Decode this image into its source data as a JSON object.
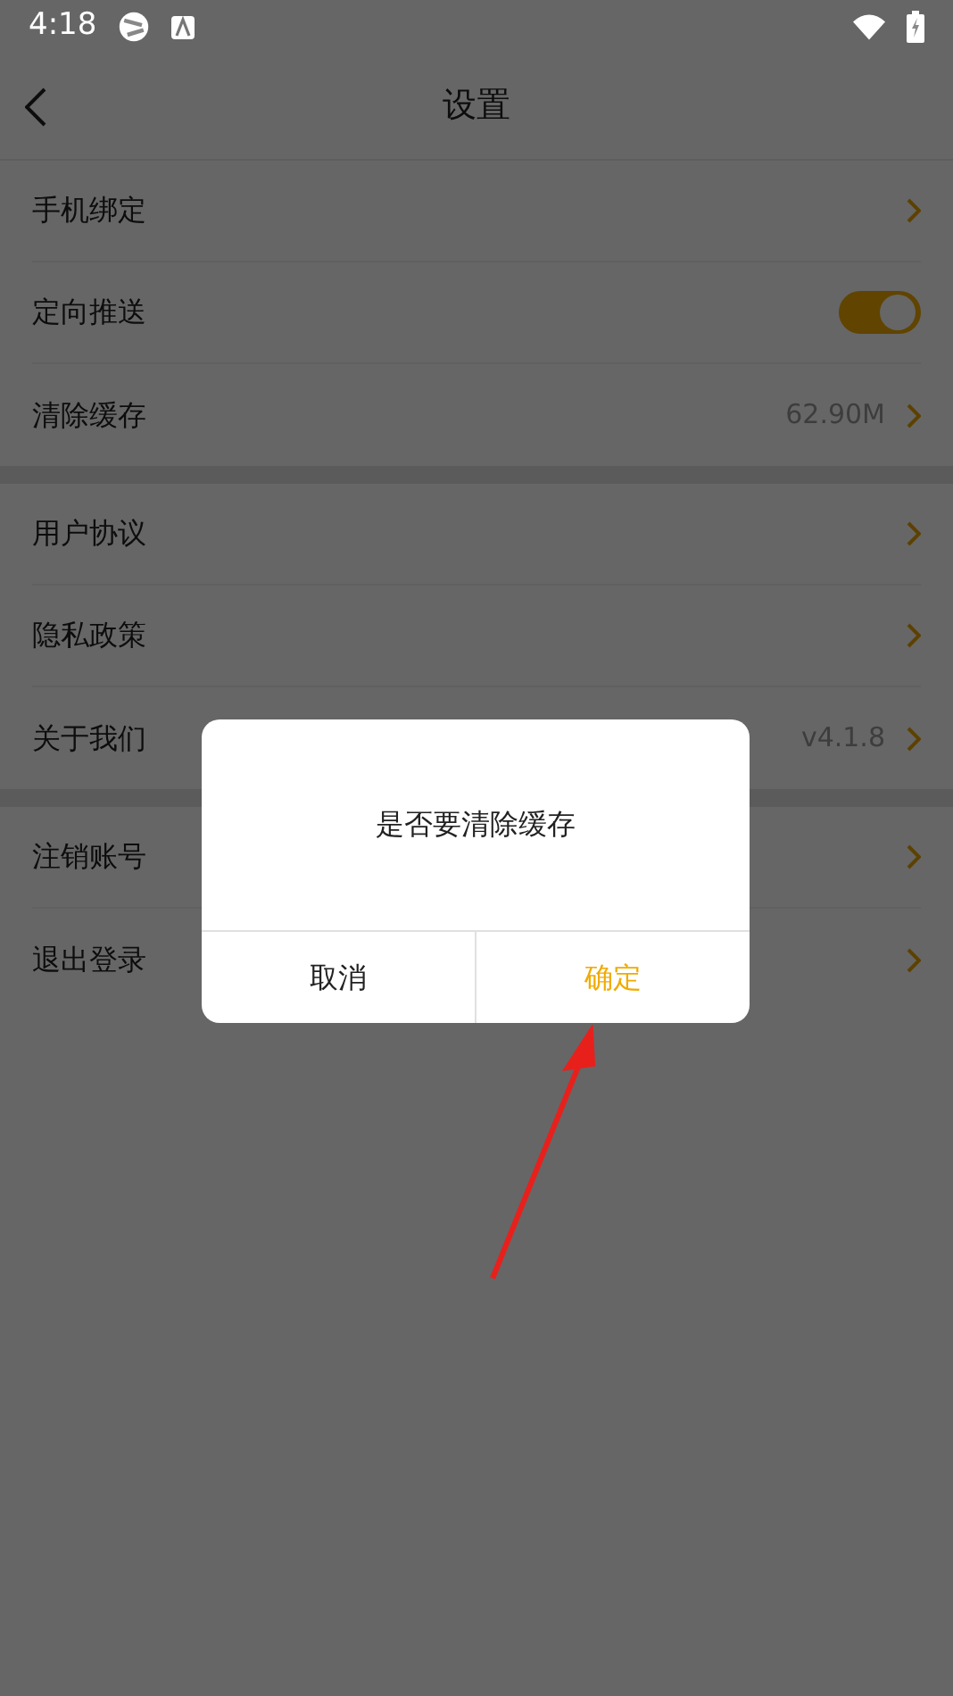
{
  "status_bar": {
    "time": "4:18"
  },
  "header": {
    "title": "设置"
  },
  "groups": [
    [
      {
        "kind": "link",
        "label": "手机绑定"
      },
      {
        "kind": "toggle",
        "label": "定向推送",
        "on": true
      },
      {
        "kind": "link",
        "label": "清除缓存",
        "value": "62.90M"
      }
    ],
    [
      {
        "kind": "link",
        "label": "用户协议"
      },
      {
        "kind": "link",
        "label": "隐私政策"
      },
      {
        "kind": "link",
        "label": "关于我们",
        "value": "v4.1.8"
      }
    ],
    [
      {
        "kind": "link",
        "label": "注销账号"
      },
      {
        "kind": "link",
        "label": "退出登录"
      }
    ]
  ],
  "dialog": {
    "message": "是否要清除缓存",
    "buttons": [
      {
        "label": "取消",
        "primary": false
      },
      {
        "label": "确定",
        "primary": true
      }
    ]
  }
}
